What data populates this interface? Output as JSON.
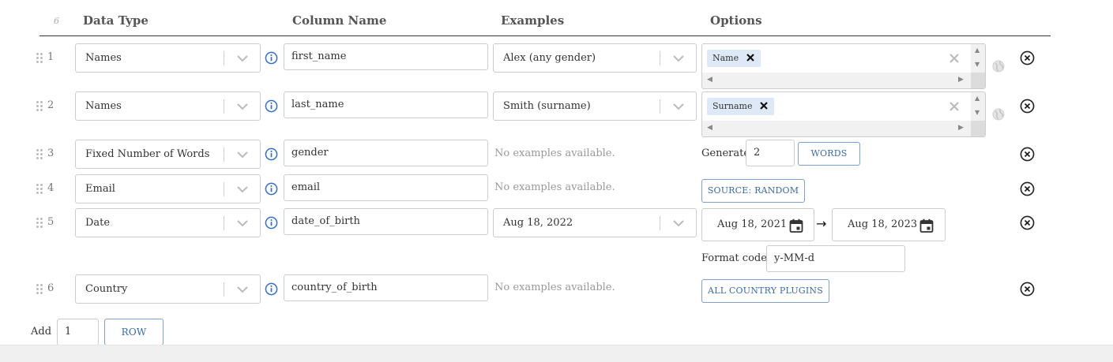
{
  "header": {
    "row_count": "6",
    "data_type": "Data Type",
    "column_name": "Column Name",
    "examples": "Examples",
    "options": "Options"
  },
  "rows": [
    {
      "num": "1",
      "data_type": "Names",
      "column_name": "first_name",
      "example": "Alex (any gender)",
      "tag": "Name"
    },
    {
      "num": "2",
      "data_type": "Names",
      "column_name": "last_name",
      "example": "Smith (surname)",
      "tag": "Surname"
    },
    {
      "num": "3",
      "data_type": "Fixed Number of Words",
      "column_name": "gender",
      "example": "No examples available.",
      "generate_label": "Generate",
      "generate_value": "2",
      "words_button": "WORDS"
    },
    {
      "num": "4",
      "data_type": "Email",
      "column_name": "email",
      "example": "No examples available.",
      "source_button": "SOURCE: RANDOM"
    },
    {
      "num": "5",
      "data_type": "Date",
      "column_name": "date_of_birth",
      "example": "Aug 18, 2022",
      "date_from": "Aug 18, 2021",
      "arrow": "→",
      "date_to": "Aug 18, 2023",
      "format_label": "Format code:",
      "format_value": "y-MM-d"
    },
    {
      "num": "6",
      "data_type": "Country",
      "column_name": "country_of_birth",
      "example": "No examples available.",
      "plugins_button": "ALL COUNTRY PLUGINS"
    }
  ],
  "footer": {
    "add_label": "Add",
    "add_value": "1",
    "row_button": "ROW"
  },
  "colors": {
    "accent": "#3a6aa8",
    "tag_bg": "#dde9f7",
    "info_blue": "#2f6fc9",
    "border": "#cccccc"
  },
  "icons": [
    "drag-handle-icon",
    "info-icon",
    "chevron-down-icon",
    "tag-remove-icon",
    "clear-icon",
    "globe-icon",
    "delete-row-icon",
    "calendar-icon"
  ]
}
